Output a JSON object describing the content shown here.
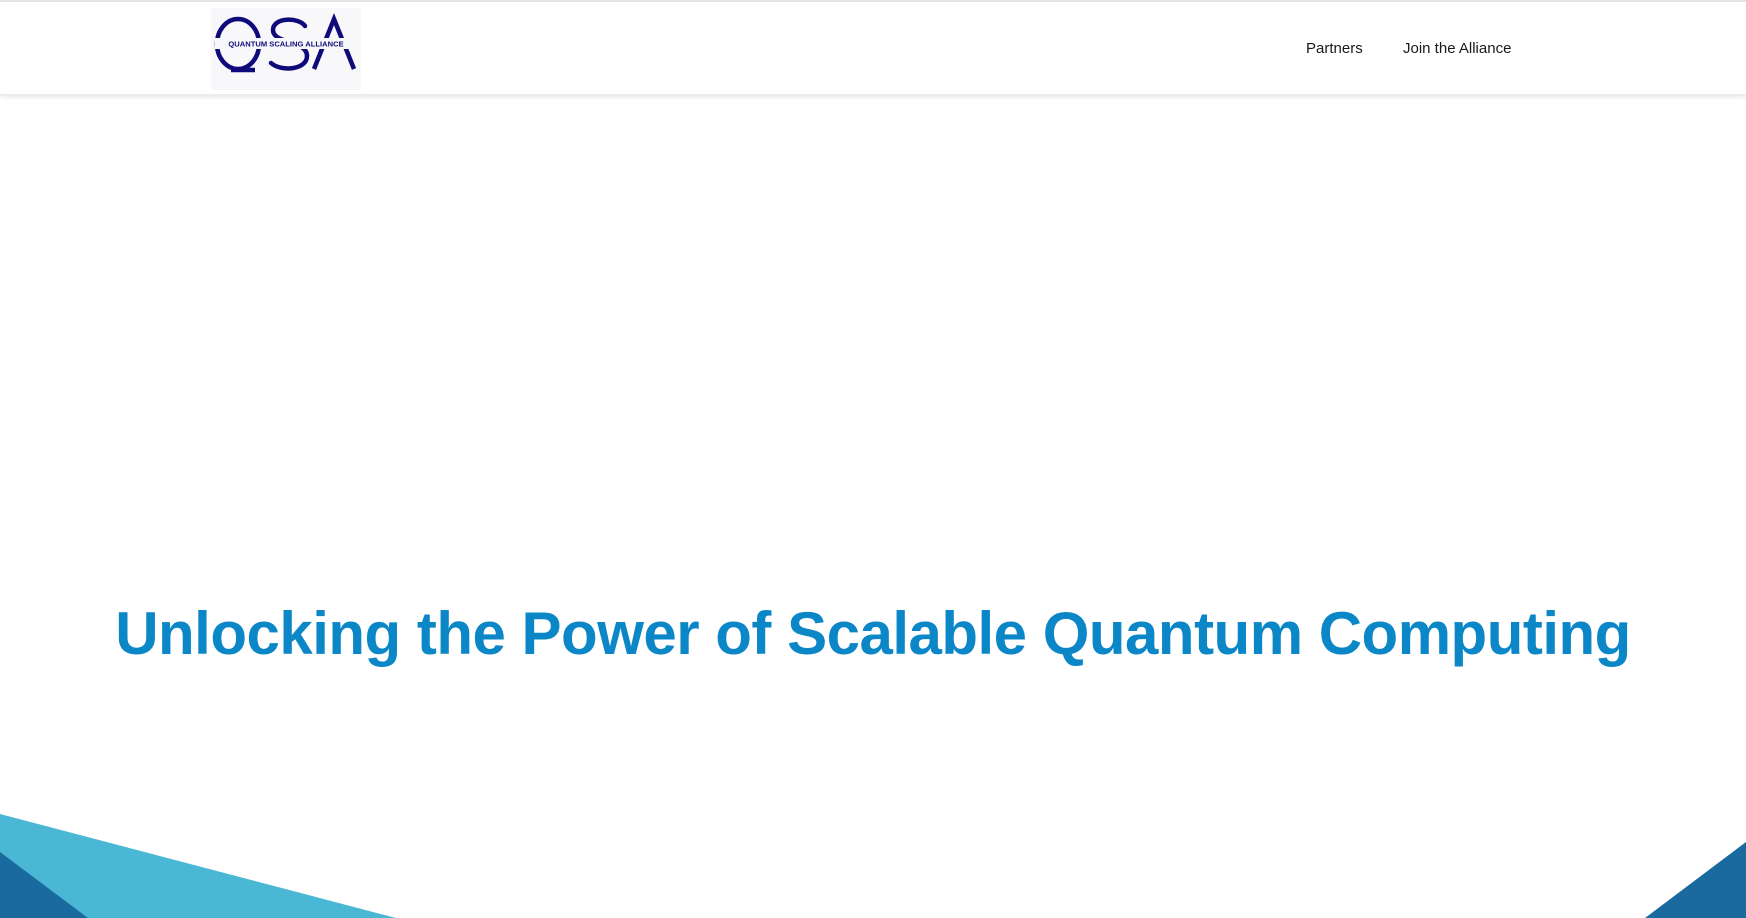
{
  "header": {
    "logo": {
      "letters": "QSA",
      "tagline": "QUANTUM SCALING ALLIANCE",
      "color": "#0f0a7a"
    },
    "nav": [
      {
        "label": "Partners"
      },
      {
        "label": "Join the Alliance"
      }
    ]
  },
  "hero": {
    "title": "Unlocking the Power of Scalable Quantum Computing",
    "title_color": "#0b87c8"
  },
  "decor": {
    "colors": {
      "light_blue": "#4ab8d4",
      "dark_blue": "#1a6aa0"
    }
  }
}
